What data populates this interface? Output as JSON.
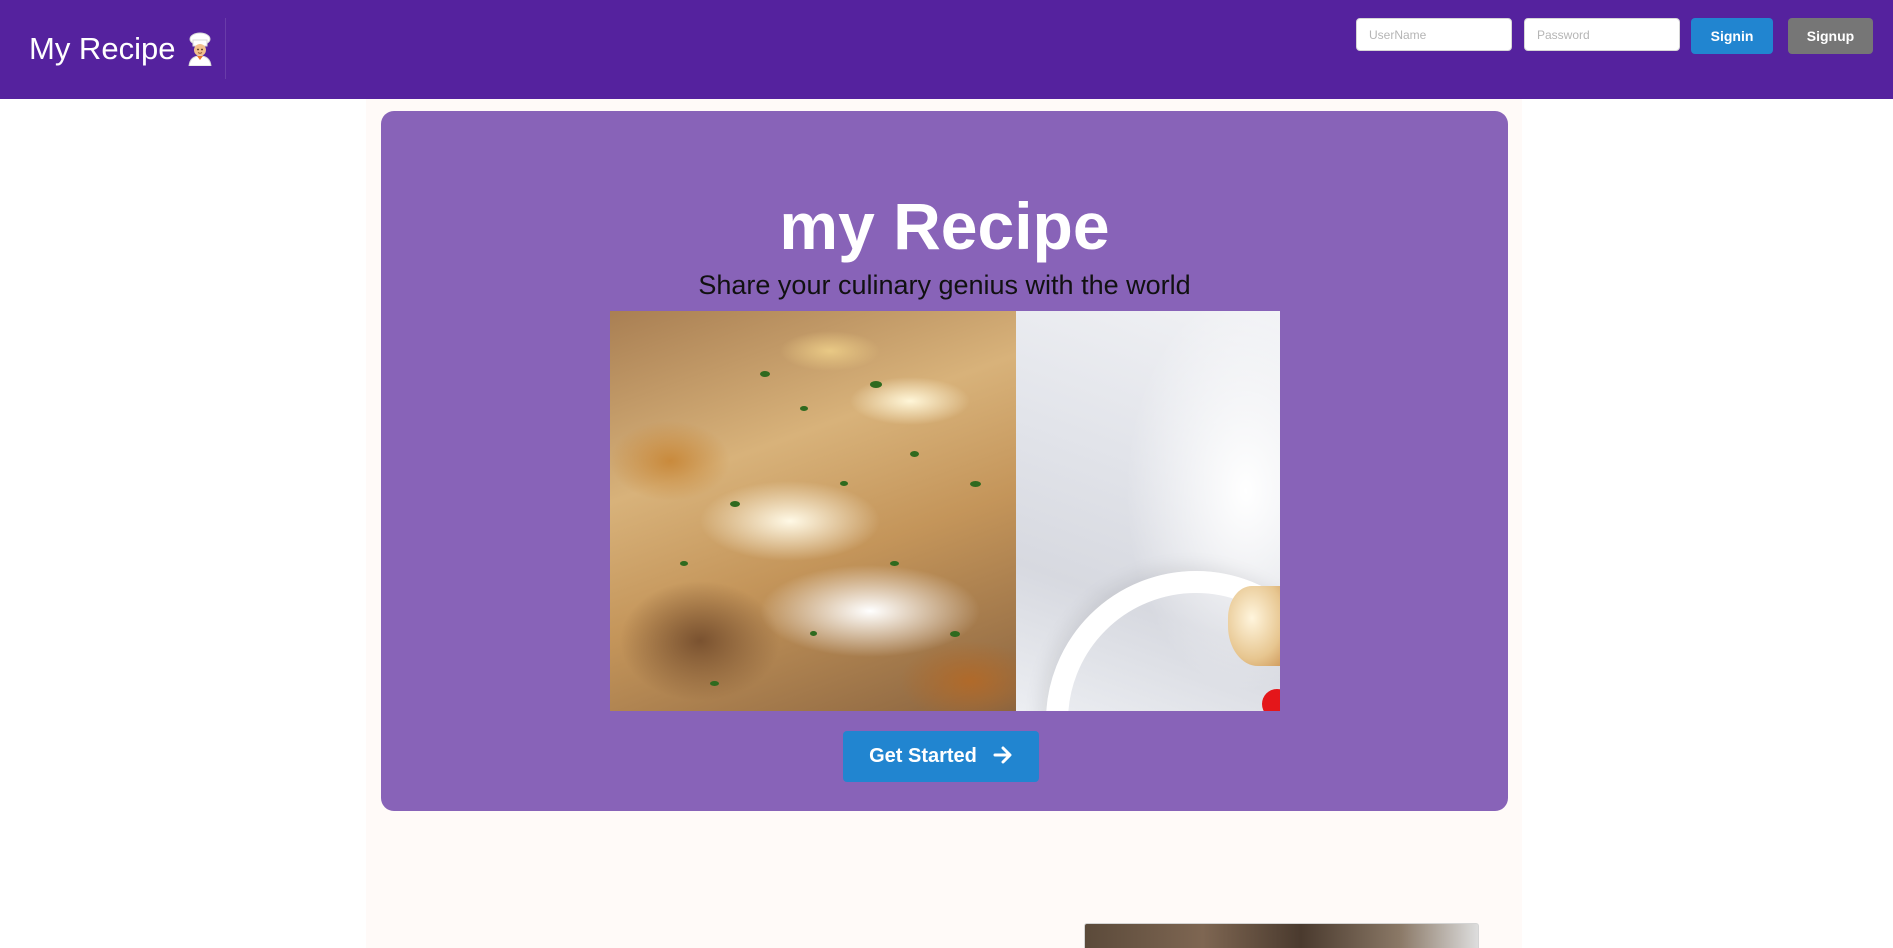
{
  "navbar": {
    "brand_text": "My Recipe",
    "brand_icon": "chef-emoji-icon",
    "username_placeholder": "UserName",
    "password_placeholder": "Password",
    "signin_label": "Signin",
    "signup_label": "Signup"
  },
  "hero": {
    "title": "my Recipe",
    "subtitle": "Share your culinary genius with the world",
    "image_icon": "food-photo",
    "cta_label": "Get Started",
    "cta_icon": "arrow-right-icon"
  },
  "colors": {
    "navbar_bg": "#55229e",
    "hero_bg": "#8863b8",
    "primary_button": "#2185d0",
    "secondary_button": "#767676"
  }
}
